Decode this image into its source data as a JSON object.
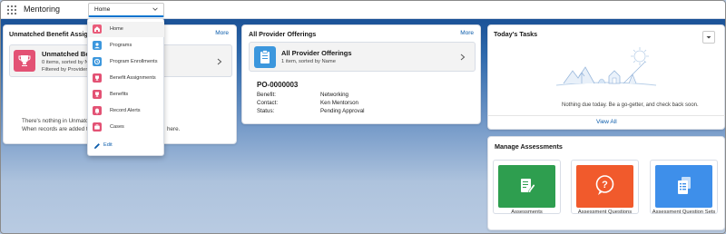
{
  "app": {
    "name": "Mentoring"
  },
  "nav": {
    "active_tab": "Home"
  },
  "menu": {
    "items": [
      {
        "label": "Home",
        "icon": "home-icon",
        "color": "#ea5c7a"
      },
      {
        "label": "Programs",
        "icon": "programs-icon",
        "color": "#3c97dd"
      },
      {
        "label": "Program Enrollments",
        "icon": "enrollments-icon",
        "color": "#3c97dd"
      },
      {
        "label": "Benefit Assignments",
        "icon": "trophy-icon",
        "color": "#e35274"
      },
      {
        "label": "Benefits",
        "icon": "trophy-icon",
        "color": "#e35274"
      },
      {
        "label": "Record Alerts",
        "icon": "bell-icon",
        "color": "#e35274"
      },
      {
        "label": "Cases",
        "icon": "case-icon",
        "color": "#e35274"
      }
    ],
    "edit_label": "Edit"
  },
  "unmatched": {
    "title": "Unmatched Benefit Assig",
    "more": "More",
    "list_title": "Unmatched Be",
    "list_sub1": "0 items, sorted by N",
    "list_sub2": "Filtered by Provider",
    "empty_line1": "There's nothing in Unmatch",
    "empty_line2": "When records are added to",
    "empty_line2_end": "here."
  },
  "offerings": {
    "title": "All Provider Offerings",
    "more": "More",
    "list_title": "All Provider Offerings",
    "list_sub": "1 item, sorted by Name",
    "record_name": "PO-0000003",
    "fields": [
      {
        "label": "Benefit:",
        "value": "Networking"
      },
      {
        "label": "Contact:",
        "value": "Ken Mentorson"
      },
      {
        "label": "Status:",
        "value": "Pending Approval"
      }
    ]
  },
  "tasks": {
    "title": "Today's Tasks",
    "empty": "Nothing due today. Be a go-getter, and check back soon.",
    "view_all": "View All"
  },
  "assessments": {
    "title": "Manage Assessments",
    "tiles": [
      {
        "label": "Assessments",
        "color": "#2e9e4f",
        "icon": "assessment-icon"
      },
      {
        "label": "Assessment Questions",
        "color": "#f15a2c",
        "icon": "question-icon"
      },
      {
        "label": "Assessment Question Sets",
        "color": "#3e8fea",
        "icon": "question-set-icon"
      }
    ]
  },
  "colors": {
    "brand": "#1b5297",
    "link": "#0b5cab",
    "accent": "#0176d3"
  }
}
